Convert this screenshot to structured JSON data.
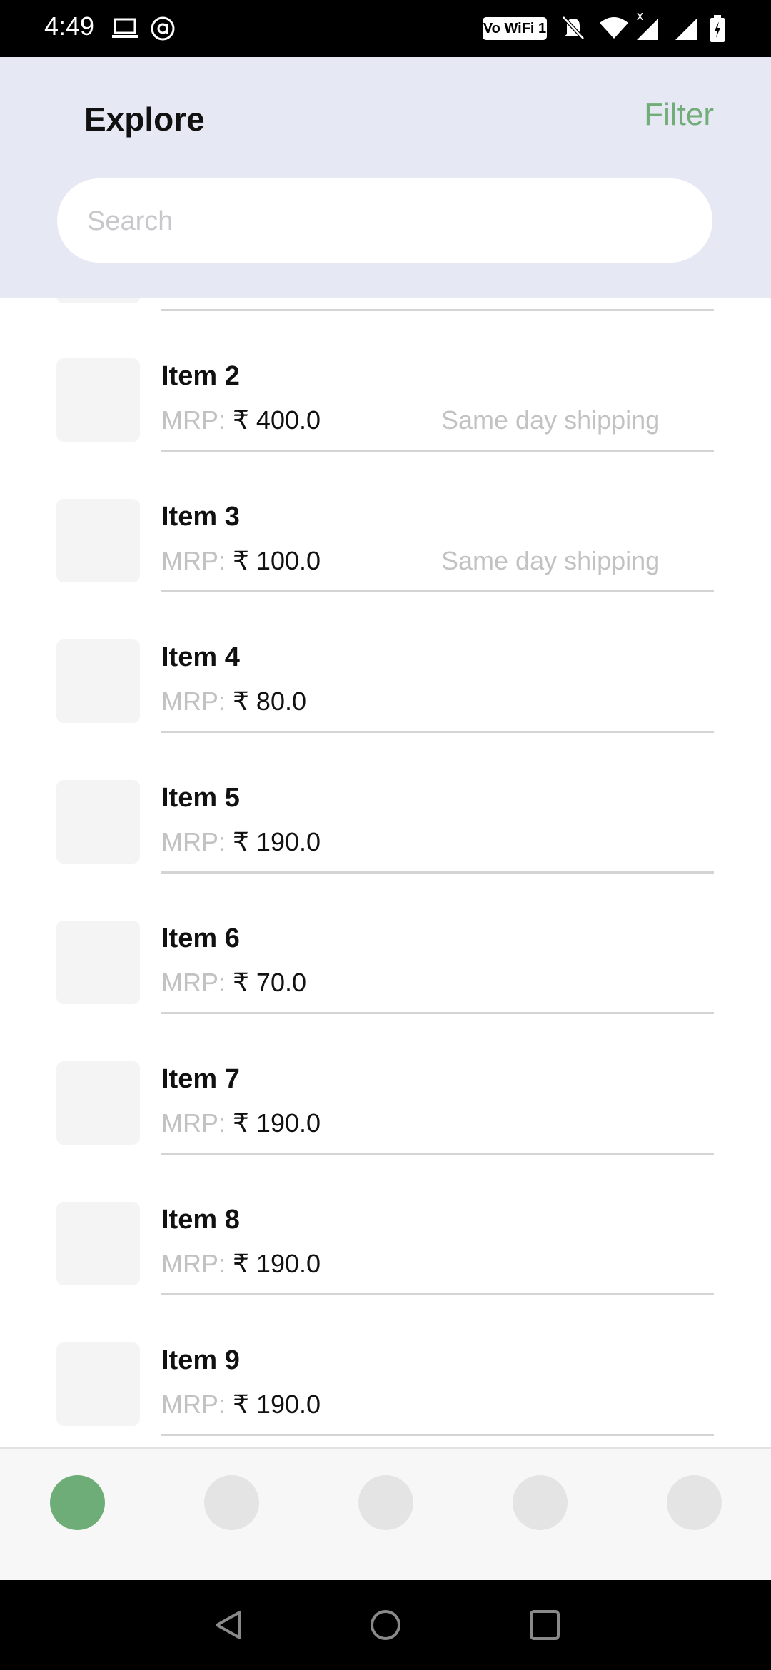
{
  "status_bar": {
    "time": "4:49",
    "wifi_badge": "Vo WiFi 1",
    "icons": [
      "laptop-icon",
      "circle-a-icon",
      "bell-off-icon",
      "wifi-icon",
      "signal-icon",
      "signal-icon",
      "battery-icon"
    ]
  },
  "header": {
    "title": "Explore",
    "filter_label": "Filter"
  },
  "search": {
    "placeholder": "Search",
    "value": ""
  },
  "list": {
    "mrp_label": "MRP:",
    "items": [
      {
        "name": "Item 2",
        "price": "₹ 400.0",
        "shipping": "Same day shipping"
      },
      {
        "name": "Item 3",
        "price": "₹ 100.0",
        "shipping": "Same day shipping"
      },
      {
        "name": "Item 4",
        "price": "₹ 80.0",
        "shipping": ""
      },
      {
        "name": "Item 5",
        "price": "₹ 190.0",
        "shipping": ""
      },
      {
        "name": "Item 6",
        "price": "₹ 70.0",
        "shipping": ""
      },
      {
        "name": "Item 7",
        "price": "₹ 190.0",
        "shipping": ""
      },
      {
        "name": "Item 8",
        "price": "₹ 190.0",
        "shipping": ""
      },
      {
        "name": "Item 9",
        "price": "₹ 190.0",
        "shipping": ""
      }
    ]
  },
  "bottom_nav": {
    "tabs": [
      {
        "name": "nav-tab-1",
        "active": true
      },
      {
        "name": "nav-tab-2",
        "active": false
      },
      {
        "name": "nav-tab-3",
        "active": false
      },
      {
        "name": "nav-tab-4",
        "active": false
      },
      {
        "name": "nav-tab-5",
        "active": false
      }
    ],
    "active_color": "#6ead77",
    "inactive_color": "#e4e4e4"
  },
  "system_nav": {
    "buttons": [
      "back-icon",
      "home-icon",
      "recents-icon"
    ]
  }
}
